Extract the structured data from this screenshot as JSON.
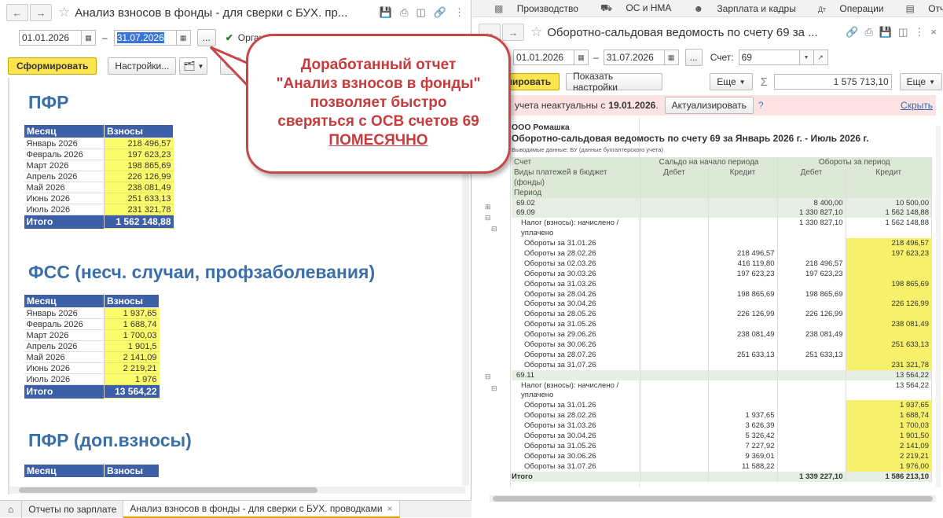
{
  "left": {
    "title": "Анализ взносов в фонды - для сверки с БУХ. пр...",
    "date_from": "01.01.2026",
    "date_to": "31.07.2026",
    "org_label": "Органи",
    "generate_label": "Сформировать",
    "settings_label": "Настройки...",
    "pfr": {
      "title": "ПФР",
      "col_month": "Месяц",
      "col_value": "Взносы",
      "rows": [
        {
          "m": "Январь 2026",
          "v": "218 496,57"
        },
        {
          "m": "Февраль 2026",
          "v": "197 623,23"
        },
        {
          "m": "Март 2026",
          "v": "198 865,69"
        },
        {
          "m": "Апрель 2026",
          "v": "226 126,99"
        },
        {
          "m": "Май 2026",
          "v": "238 081,49"
        },
        {
          "m": "Июнь 2026",
          "v": "251 633,13"
        },
        {
          "m": "Июль 2026",
          "v": "231 321,78"
        }
      ],
      "total_label": "Итого",
      "total": "1 562 148,88"
    },
    "fss": {
      "title": "ФСС (несч. случаи, профзаболевания)",
      "col_month": "Месяц",
      "col_value": "Взносы",
      "rows": [
        {
          "m": "Январь 2026",
          "v": "1 937,65"
        },
        {
          "m": "Февраль 2026",
          "v": "1 688,74"
        },
        {
          "m": "Март 2026",
          "v": "1 700,03"
        },
        {
          "m": "Апрель 2026",
          "v": "1 901,5"
        },
        {
          "m": "Май 2026",
          "v": "2 141,09"
        },
        {
          "m": "Июнь 2026",
          "v": "2 219,21"
        },
        {
          "m": "Июль 2026",
          "v": "1 976"
        }
      ],
      "total_label": "Итого",
      "total": "13 564,22"
    },
    "pfr_dop": {
      "title": "ПФР (доп.взносы)",
      "col_month": "Месяц",
      "col_value": "Взносы"
    }
  },
  "tabs": [
    "Отчеты по зарплате",
    "Анализ взносов в фонды - для сверки с БУХ. проводками"
  ],
  "bubble": {
    "line1": "Доработанный отчет",
    "line2": "\"Анализ взносов в фонды\"",
    "line3": "позволяет быстро",
    "line4": "сверяться с ОСВ счетов 69",
    "line5": "ПОМЕСЯЧНО"
  },
  "right": {
    "menu": [
      "Производство",
      "ОС и НМА",
      "Зарплата и кадры",
      "Операции",
      "Отчеты"
    ],
    "title": "Оборотно-сальдовая ведомость по счету 69 за ...",
    "date_from": "01.01.2026",
    "date_to": "31.07.2026",
    "account_label": "Счет:",
    "account": "69",
    "generate_label": "Сформировать",
    "show_settings_label": "Показать настройки",
    "more_label": "Еще",
    "sum_value": "1 575 713,10",
    "warning_prefix": "учета неактуальны с",
    "warning_date": "19.01.2026",
    "actualize_label": "Актуализировать",
    "hide_label": "Скрыть",
    "org": "ООО Ромашка",
    "report_title": "Оборотно-сальдовая ведомость по счету 69 за Январь 2026 г. - Июль 2026 г.",
    "report_sub": "Выводимые данные:  БУ (данные бухгалтерского учета)",
    "hdr": {
      "account": "Счет",
      "saldo": "Сальдо на начало периода",
      "turnover": "Обороты за период",
      "debit": "Дебет",
      "credit": "Кредит",
      "sub1": "Виды платежей в бюджет",
      "sub1b": "(фонды)",
      "sub2": "Период"
    },
    "rows": [
      {
        "k": "grp",
        "name": "69.02",
        "c3": "8 400,00",
        "c4": "10 500,00"
      },
      {
        "k": "grp",
        "name": "69.09",
        "c3": "1 330 827,10",
        "c4": "1 562 148,88"
      },
      {
        "k": "sub",
        "name": "Налог (взносы): начислено /",
        "c3": "1 330 827,10",
        "c4": "1 562 148,88"
      },
      {
        "k": "sub2",
        "name": "уплачено"
      },
      {
        "k": "p",
        "name": "Обороты за 31.01.26",
        "c4": "218 496,57",
        "y": true
      },
      {
        "k": "p",
        "name": "Обороты за 28.02.26",
        "c2": "218 496,57",
        "c4": "197 623,23",
        "y": true
      },
      {
        "k": "p",
        "name": "Обороты за 02.03.26",
        "c2": "416 119,80",
        "c3": "218 496,57",
        "y": true
      },
      {
        "k": "p",
        "name": "Обороты за 30.03.26",
        "c2": "197 623,23",
        "c3": "197 623,23",
        "y": true
      },
      {
        "k": "p",
        "name": "Обороты за 31.03.26",
        "c4": "198 865,69",
        "y": true
      },
      {
        "k": "p",
        "name": "Обороты за 28.04.26",
        "c2": "198 865,69",
        "c3": "198 865,69",
        "y": true
      },
      {
        "k": "p",
        "name": "Обороты за 30.04.26",
        "c4": "226 126,99",
        "y": true
      },
      {
        "k": "p",
        "name": "Обороты за 28.05.26",
        "c2": "226 126,99",
        "c3": "226 126,99",
        "y": true
      },
      {
        "k": "p",
        "name": "Обороты за 31.05.26",
        "c4": "238 081,49",
        "y": true
      },
      {
        "k": "p",
        "name": "Обороты за 29.06.26",
        "c2": "238 081,49",
        "c3": "238 081,49",
        "y": true
      },
      {
        "k": "p",
        "name": "Обороты за 30.06.26",
        "c4": "251 633,13",
        "y": true
      },
      {
        "k": "p",
        "name": "Обороты за 28.07.26",
        "c2": "251 633,13",
        "c3": "251 633,13",
        "y": true
      },
      {
        "k": "p",
        "name": "Обороты за 31.07.26",
        "c4": "231 321,78",
        "y": true
      },
      {
        "k": "grp",
        "name": "69.11",
        "c4": "13 564,22"
      },
      {
        "k": "sub",
        "name": "Налог (взносы): начислено /",
        "c4": "13 564,22"
      },
      {
        "k": "sub2",
        "name": "уплачено"
      },
      {
        "k": "p",
        "name": "Обороты за 31.01.26",
        "c4": "1 937,65",
        "y": true
      },
      {
        "k": "p",
        "name": "Обороты за 28.02.26",
        "c2": "1 937,65",
        "c4": "1 688,74",
        "y": true
      },
      {
        "k": "p",
        "name": "Обороты за 31.03.26",
        "c2": "3 626,39",
        "c4": "1 700,03",
        "y": true
      },
      {
        "k": "p",
        "name": "Обороты за 30.04.26",
        "c2": "5 326,42",
        "c4": "1 901,50",
        "y": true
      },
      {
        "k": "p",
        "name": "Обороты за 31.05.26",
        "c2": "7 227,92",
        "c4": "2 141,09",
        "y": true
      },
      {
        "k": "p",
        "name": "Обороты за 30.06.26",
        "c2": "9 369,01",
        "c4": "2 219,21",
        "y": true
      },
      {
        "k": "p",
        "name": "Обороты за 31.07.26",
        "c2": "11 588,22",
        "c4": "1 976,00",
        "y": true
      },
      {
        "k": "tot",
        "name": "Итого",
        "c3": "1 339 227,10",
        "c4": "1 586 213,10"
      }
    ]
  }
}
